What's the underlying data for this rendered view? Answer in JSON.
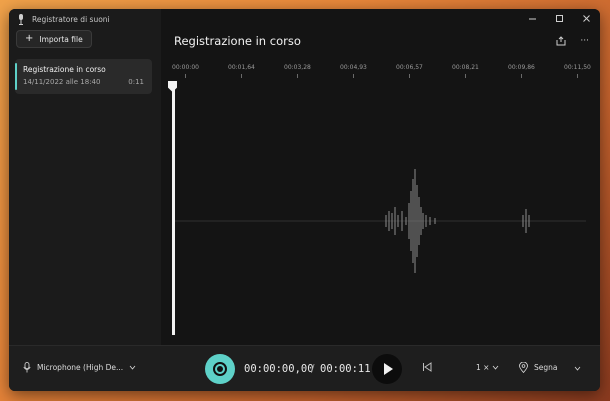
{
  "app": {
    "title": "Registratore di suoni"
  },
  "sidebar": {
    "import_label": "Importa file",
    "recordings": [
      {
        "name": "Registrazione in corso",
        "date": "14/11/2022 alle 18:40",
        "duration": "0:11"
      }
    ]
  },
  "main": {
    "title": "Registrazione in corso",
    "timeline_ticks": [
      "00:00:00",
      "00:01,64",
      "00:03,28",
      "00:04,93",
      "00:06,57",
      "00:08,21",
      "00:09,86",
      "00:11,50"
    ]
  },
  "controls": {
    "microphone_label": "Microphone (High De...",
    "time_current": "00:00:00,00",
    "time_separator": "/",
    "time_total": "00:00:11",
    "speed_label": "1 ×",
    "mark_label": "Segna"
  },
  "colors": {
    "accent": "#5ed1c8",
    "background": "#111111"
  }
}
